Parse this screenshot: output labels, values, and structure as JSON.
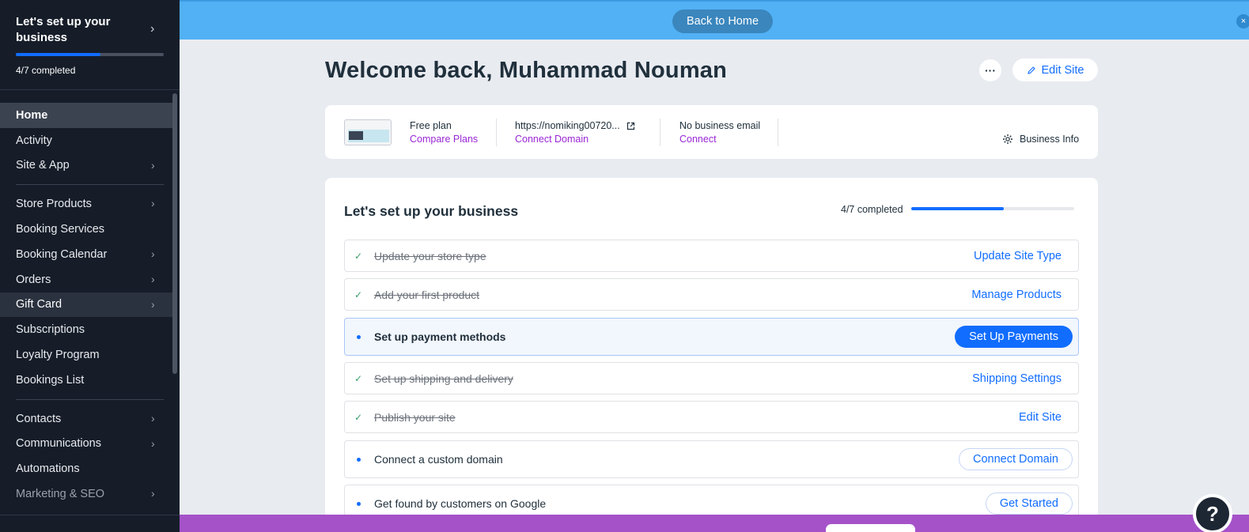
{
  "sidebar": {
    "setup_title": "Let's set up your business",
    "setup_progress_fraction": 0.57,
    "setup_count": "4/7 completed",
    "items": [
      {
        "label": "Home",
        "chevron": false
      },
      {
        "label": "Activity",
        "chevron": false
      },
      {
        "label": "Site & App",
        "chevron": true
      },
      {
        "label": "Store Products",
        "chevron": true
      },
      {
        "label": "Booking Services",
        "chevron": false
      },
      {
        "label": "Booking Calendar",
        "chevron": true
      },
      {
        "label": "Orders",
        "chevron": true
      },
      {
        "label": "Gift Card",
        "chevron": true
      },
      {
        "label": "Subscriptions",
        "chevron": false
      },
      {
        "label": "Loyalty Program",
        "chevron": false
      },
      {
        "label": "Bookings List",
        "chevron": false
      },
      {
        "label": "Contacts",
        "chevron": true
      },
      {
        "label": "Communications",
        "chevron": true
      },
      {
        "label": "Automations",
        "chevron": false
      },
      {
        "label": "Marketing & SEO",
        "chevron": true
      }
    ]
  },
  "topbar": {
    "back_label": "Back to Home"
  },
  "header": {
    "welcome": "Welcome back, Muhammad Nouman",
    "more_label": "···",
    "edit_site_label": "Edit Site"
  },
  "info": {
    "plan": "Free plan",
    "compare_plans": "Compare Plans",
    "url": "https://nomiking00720...",
    "connect_domain": "Connect Domain",
    "email_status": "No business email",
    "connect": "Connect",
    "business_info": "Business Info"
  },
  "setup": {
    "title": "Let's set up your business",
    "count": "4/7 completed",
    "progress_fraction": 0.57,
    "tasks": [
      {
        "label": "Update your store type",
        "action": "Update Site Type",
        "state": "done"
      },
      {
        "label": "Add your first product",
        "action": "Manage Products",
        "state": "done"
      },
      {
        "label": "Set up payment methods",
        "action": "Set Up Payments",
        "state": "current"
      },
      {
        "label": "Set up shipping and delivery",
        "action": "Shipping Settings",
        "state": "done"
      },
      {
        "label": "Publish your site",
        "action": "Edit Site",
        "state": "done"
      },
      {
        "label": "Connect a custom domain",
        "action": "Connect Domain",
        "state": "todo"
      },
      {
        "label": "Get found by customers on Google",
        "action": "Get Started",
        "state": "todo"
      }
    ]
  },
  "help": {
    "label": "?"
  },
  "colors": {
    "accent": "#116dff",
    "sidebar_bg": "#161d29",
    "banner": "#52b1f5",
    "link_purple": "#9a27d5",
    "bottom_bar": "#a552c9"
  }
}
